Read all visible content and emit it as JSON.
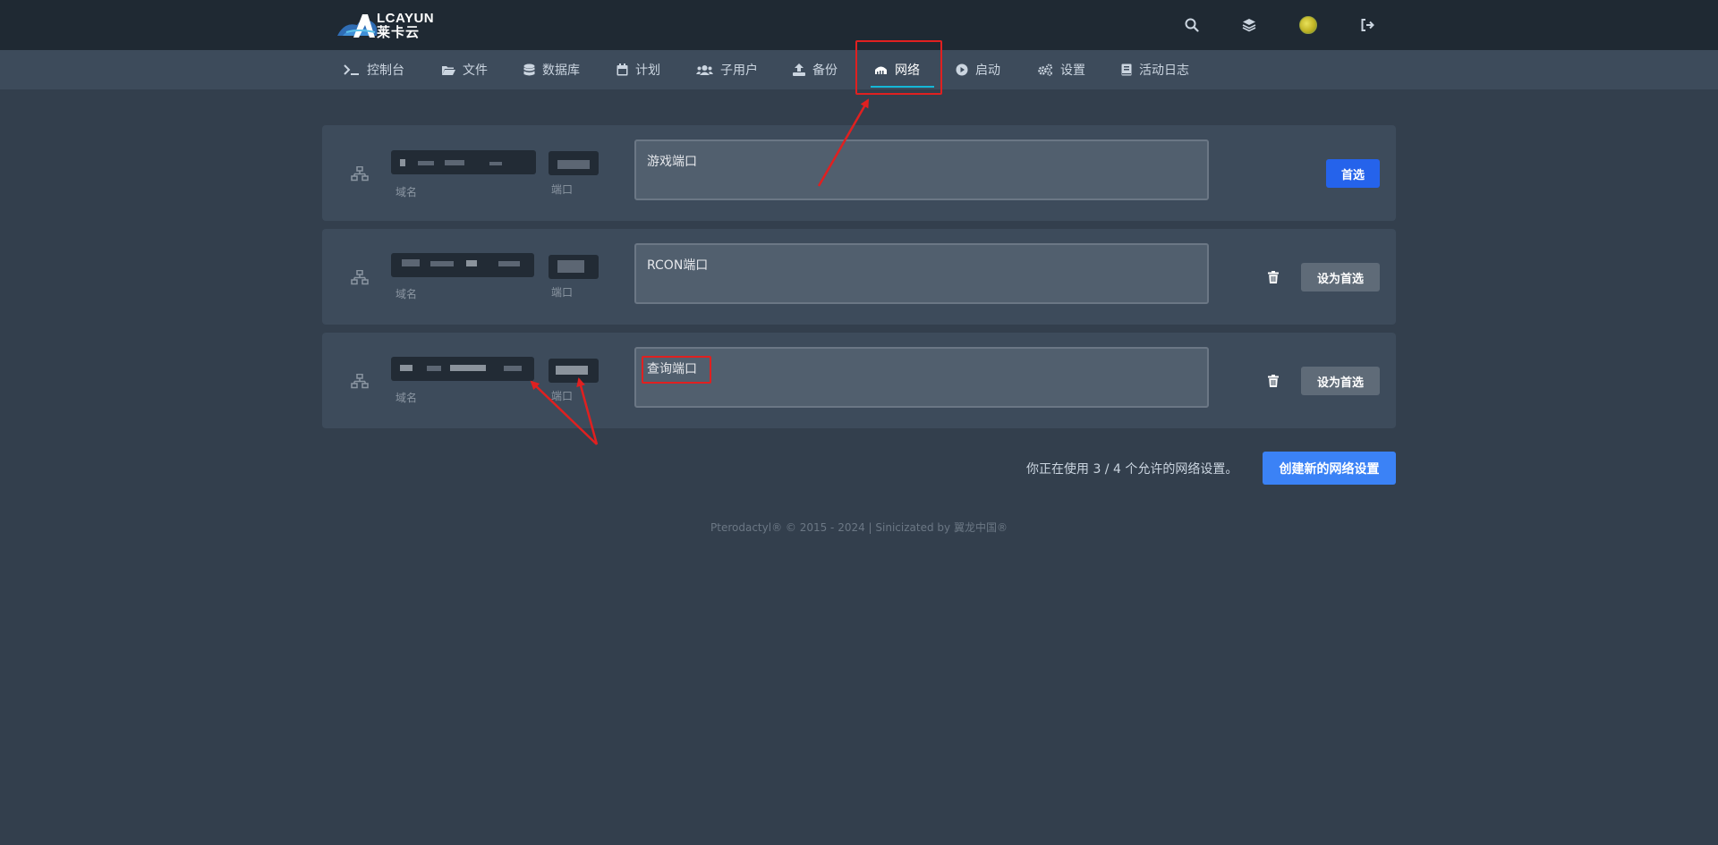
{
  "brand": {
    "logo_text_en": "LCAYUN",
    "logo_text_cn": "莱卡云"
  },
  "topbar": {
    "icons": [
      "search-icon",
      "layers-icon",
      "avatar",
      "logout-icon"
    ]
  },
  "nav": {
    "items": [
      {
        "label": "控制台",
        "icon": "terminal-icon"
      },
      {
        "label": "文件",
        "icon": "folder-icon"
      },
      {
        "label": "数据库",
        "icon": "database-icon"
      },
      {
        "label": "计划",
        "icon": "calendar-icon"
      },
      {
        "label": "子用户",
        "icon": "users-icon"
      },
      {
        "label": "备份",
        "icon": "upload-icon"
      },
      {
        "label": "网络",
        "icon": "network-icon",
        "active": true
      },
      {
        "label": "启动",
        "icon": "play-icon"
      },
      {
        "label": "设置",
        "icon": "cogs-icon"
      },
      {
        "label": "活动日志",
        "icon": "book-icon"
      }
    ]
  },
  "allocations": [
    {
      "domain_label": "域名",
      "port_label": "端口",
      "notes": "游戏端口",
      "primary": true,
      "action": "首选"
    },
    {
      "domain_label": "域名",
      "port_label": "端口",
      "notes": "RCON端口",
      "primary": false,
      "action": "设为首选"
    },
    {
      "domain_label": "域名",
      "port_label": "端口",
      "notes": "查询端口",
      "primary": false,
      "action": "设为首选"
    }
  ],
  "usage_text": "你正在使用 3 / 4 个允许的网络设置。",
  "create_button": "创建新的网络设置",
  "footer": "Pterodactyl® © 2015 - 2024 | Sinicizated by 翼龙中国®",
  "colors": {
    "background": "#333f4d",
    "topbar": "#1f2933",
    "card": "#3d4b5b",
    "primary": "#2563eb",
    "accent": "#14b8d8",
    "annotation": "#e02020"
  }
}
